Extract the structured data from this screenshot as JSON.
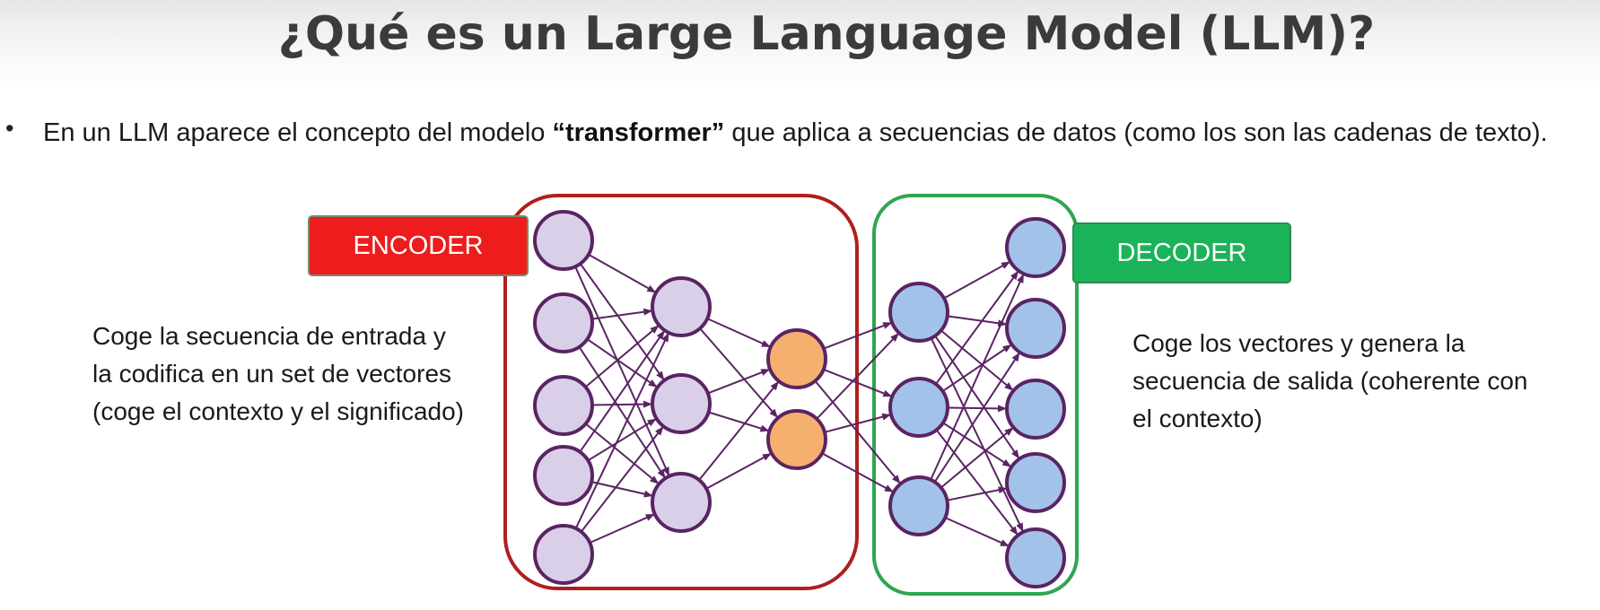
{
  "title": "¿Qué es un Large Language Model (LLM)?",
  "intro": {
    "bullet": "•",
    "text_before": "En un LLM aparece el concepto del modelo ",
    "bold": "“transformer”",
    "text_after": " que aplica a secuencias de datos (como los son las cadenas de texto)."
  },
  "encoder": {
    "label": "ENCODER",
    "description": "Coge la secuencia de entrada y la codifica en un set de vectores (coge el contexto y el significado)"
  },
  "decoder": {
    "label": "DECODER",
    "description": "Coge los vectores y genera la secuencia de salida (coherente con el contexto)"
  },
  "network": {
    "layers": [
      {
        "name": "input",
        "nodes": 5,
        "color": "#d9cfe9"
      },
      {
        "name": "encoder-hidden",
        "nodes": 3,
        "color": "#d9cfe9"
      },
      {
        "name": "latent",
        "nodes": 2,
        "color": "#f5b06f"
      },
      {
        "name": "decoder-hidden",
        "nodes": 3,
        "color": "#a3c2ea"
      },
      {
        "name": "output",
        "nodes": 5,
        "color": "#a3c2ea"
      }
    ],
    "node_stroke": "#5a2463",
    "edge_color": "#5a2463",
    "encoder_frame_color": "#b01e1e",
    "decoder_frame_color": "#2ea64f"
  }
}
